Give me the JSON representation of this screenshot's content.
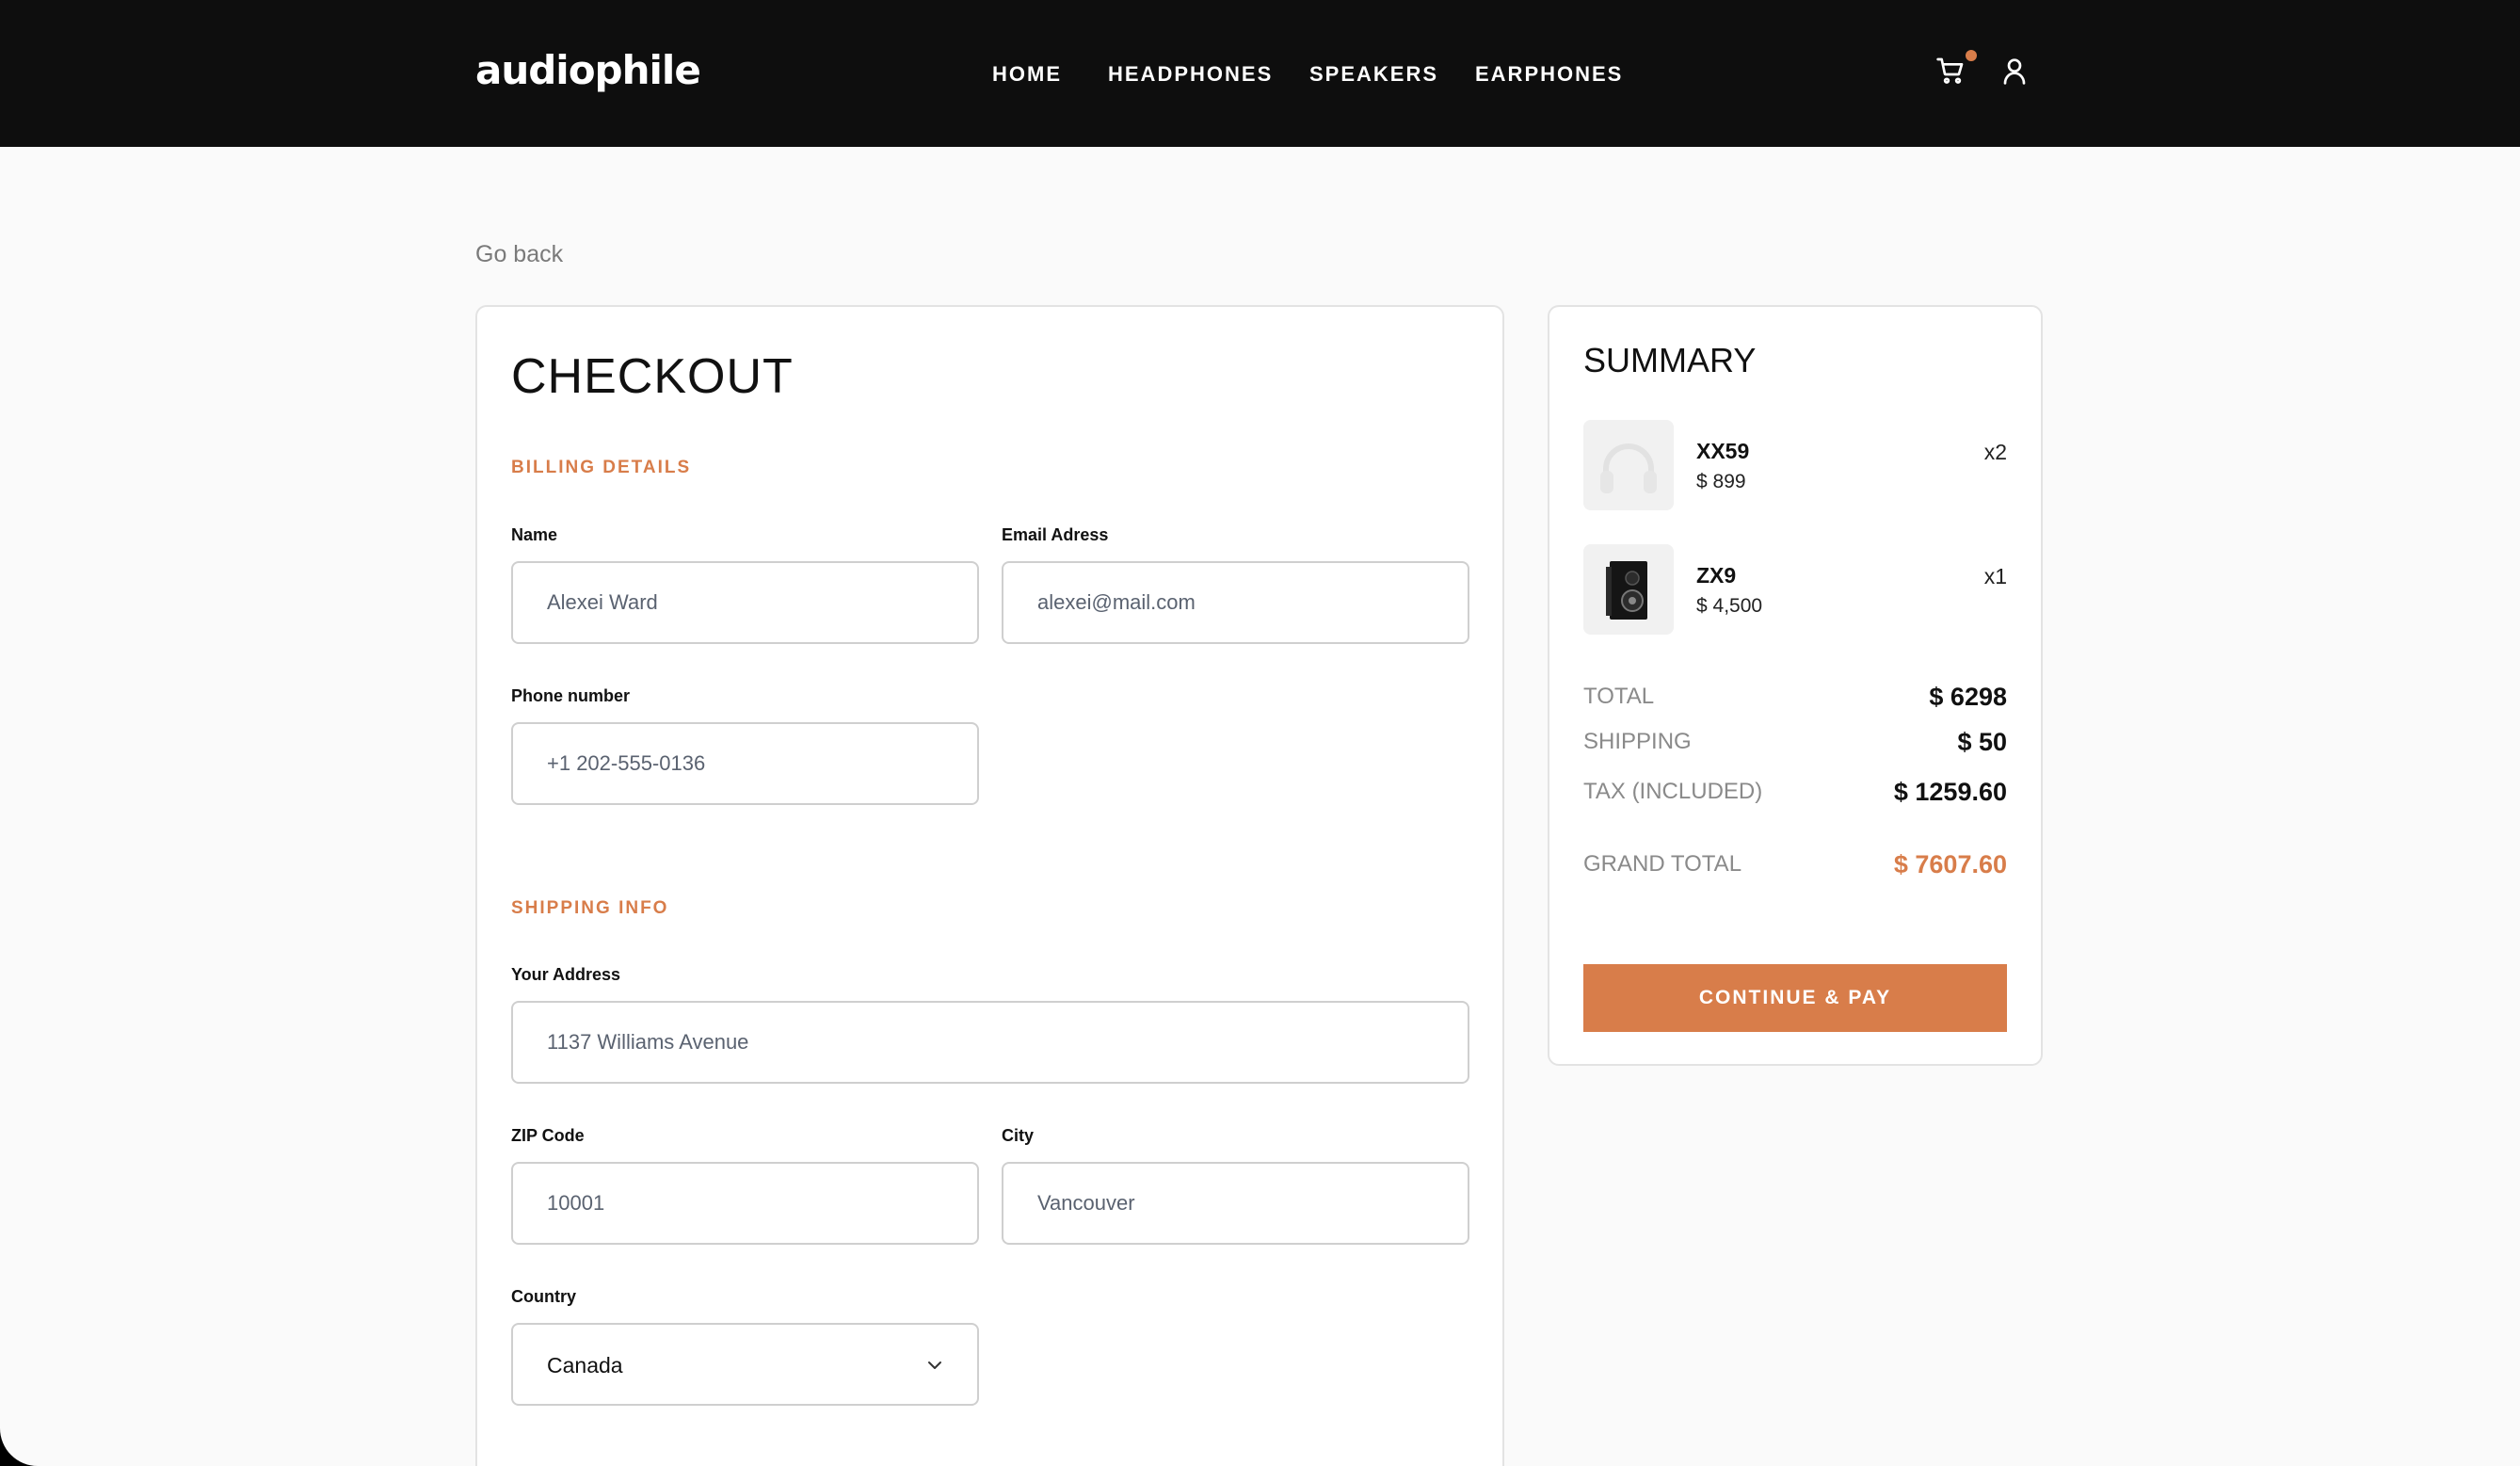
{
  "header": {
    "logo": "audiophile",
    "nav": [
      "HOME",
      "HEADPHONES",
      "SPEAKERS",
      "EARPHONES"
    ],
    "icons": [
      "cart-icon",
      "user-icon"
    ],
    "cart_badge_color": "#D87D4A"
  },
  "go_back": "Go back",
  "checkout": {
    "title": "CHECKOUT",
    "billing": {
      "title": "BILLING DETAILS",
      "name_label": "Name",
      "name_value": "Alexei Ward",
      "email_label": "Email Adress",
      "email_value": "alexei@mail.com",
      "phone_label": "Phone number",
      "phone_value": "+1 202-555-0136"
    },
    "shipping": {
      "title": "SHIPPING INFO",
      "address_label": "Your Address",
      "address_value": "1137 Williams Avenue",
      "zip_label": "ZIP Code",
      "zip_value": "10001",
      "city_label": "City",
      "city_value": "Vancouver",
      "country_label": "Country",
      "country_value": "Canada"
    }
  },
  "summary": {
    "title": "SUMMARY",
    "items": [
      {
        "name": "XX59",
        "price": "$ 899",
        "qty": "x2",
        "icon": "headphones-image"
      },
      {
        "name": "ZX9",
        "price": "$ 4,500",
        "qty": "x1",
        "icon": "speaker-image"
      }
    ],
    "total_label": "TOTAL",
    "total_value": "$ 6298",
    "shipping_label": "SHIPPING",
    "shipping_value": "$ 50",
    "tax_label": "TAX (INCLUDED)",
    "tax_value": "$ 1259.60",
    "grand_label": "GRAND TOTAL",
    "grand_value": "$ 7607.60",
    "pay_button": "CONTINUE & PAY"
  },
  "colors": {
    "accent": "#D87D4A",
    "header_bg": "#0E0E0E",
    "page_bg": "#FAFAFA"
  }
}
